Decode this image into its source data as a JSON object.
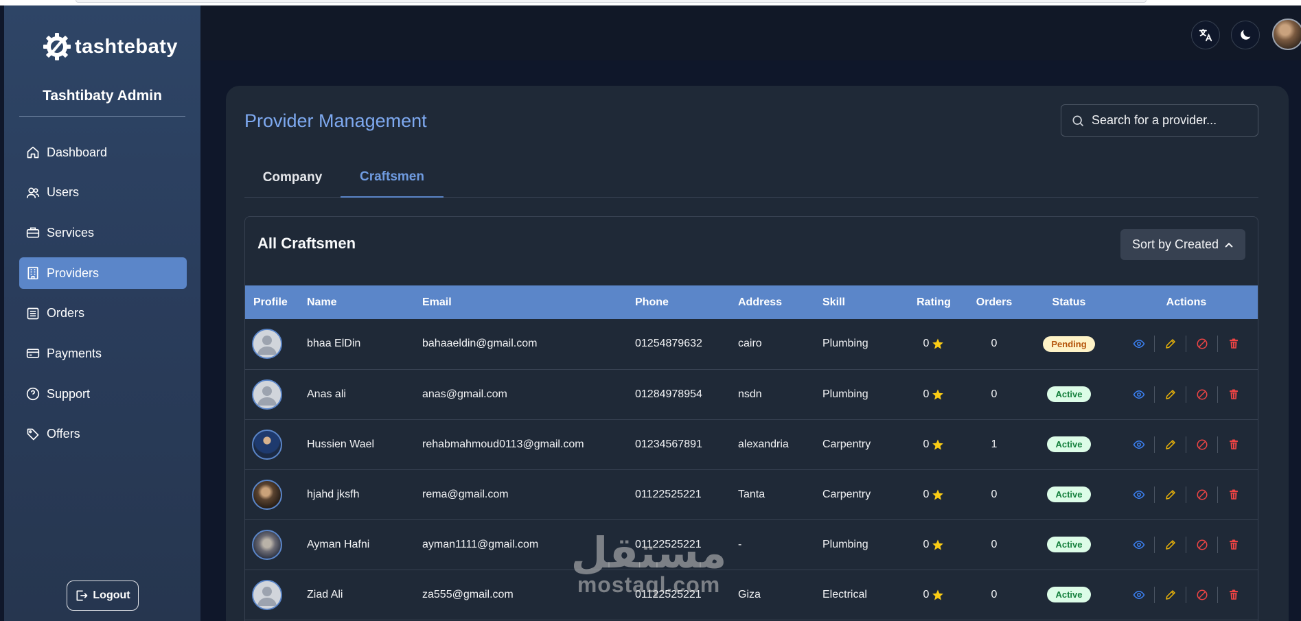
{
  "brand": {
    "name": "tashtebaty",
    "admin_title": "Tashtibaty Admin"
  },
  "sidebar": {
    "items": [
      {
        "label": "Dashboard",
        "icon": "home-icon",
        "active": false
      },
      {
        "label": "Users",
        "icon": "users-icon",
        "active": false
      },
      {
        "label": "Services",
        "icon": "briefcase-icon",
        "active": false
      },
      {
        "label": "Providers",
        "icon": "building-icon",
        "active": true
      },
      {
        "label": "Orders",
        "icon": "list-icon",
        "active": false
      },
      {
        "label": "Payments",
        "icon": "credit-card-icon",
        "active": false
      },
      {
        "label": "Support",
        "icon": "help-circle-icon",
        "active": false
      },
      {
        "label": "Offers",
        "icon": "tag-icon",
        "active": false
      }
    ],
    "logout_label": "Logout"
  },
  "header": {
    "icons": [
      "translate-icon",
      "moon-icon"
    ]
  },
  "page": {
    "title": "Provider Management",
    "search_placeholder": "Search for a provider...",
    "tabs": [
      {
        "label": "Company",
        "active": false
      },
      {
        "label": "Craftsmen",
        "active": true
      }
    ],
    "panel_title": "All Craftsmen",
    "sort_label": "Sort by Created"
  },
  "table": {
    "columns": [
      "Profile",
      "Name",
      "Email",
      "Phone",
      "Address",
      "Skill",
      "Rating",
      "Orders",
      "Status",
      "Actions"
    ],
    "rows": [
      {
        "avatar": "default",
        "name": "bhaa ElDin",
        "email": "bahaaeldin@gmail.com",
        "phone": "01254879632",
        "address": "cairo",
        "skill": "Plumbing",
        "rating": "0",
        "orders": "0",
        "status": "Pending"
      },
      {
        "avatar": "default",
        "name": "Anas ali",
        "email": "anas@gmail.com",
        "phone": "01284978954",
        "address": "nsdn",
        "skill": "Plumbing",
        "rating": "0",
        "orders": "0",
        "status": "Active"
      },
      {
        "avatar": "photo1",
        "name": "Hussien Wael",
        "email": "rehabmahmoud0113@gmail.com",
        "phone": "01234567891",
        "address": "alexandria",
        "skill": "Carpentry",
        "rating": "0",
        "orders": "1",
        "status": "Active"
      },
      {
        "avatar": "photo2",
        "name": "hjahd jksfh",
        "email": "rema@gmail.com",
        "phone": "01122525221",
        "address": "Tanta",
        "skill": "Carpentry",
        "rating": "0",
        "orders": "0",
        "status": "Active"
      },
      {
        "avatar": "photo3",
        "name": "Ayman Hafni",
        "email": "ayman1111@gmail.com",
        "phone": "01122525221",
        "address": "-",
        "skill": "Plumbing",
        "rating": "0",
        "orders": "0",
        "status": "Active"
      },
      {
        "avatar": "default",
        "name": "Ziad Ali",
        "email": "za555@gmail.com",
        "phone": "01122525221",
        "address": "Giza",
        "skill": "Electrical",
        "rating": "0",
        "orders": "0",
        "status": "Active"
      }
    ],
    "action_icons": [
      "eye-icon",
      "pencil-icon",
      "block-icon",
      "trash-icon"
    ]
  },
  "watermark": {
    "arabic": "مستقل",
    "latin": "mostaql.com"
  },
  "colors": {
    "accent": "#5b86c9",
    "sidebar": "#2e4566",
    "card": "#1f2937",
    "background": "#0f172a",
    "star": "#facc15",
    "pending": "#b45309",
    "active": "#15803d",
    "edit": "#eab308",
    "danger": "#ef4444"
  }
}
